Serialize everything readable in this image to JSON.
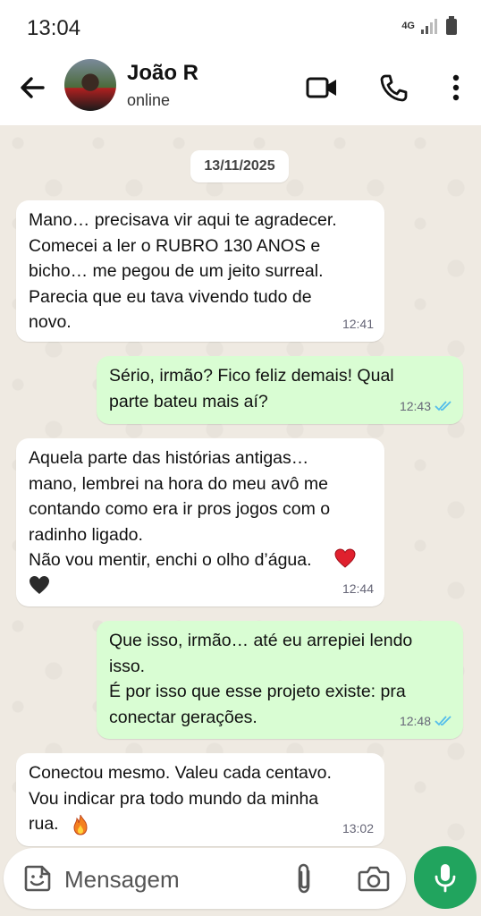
{
  "status_bar": {
    "time": "13:04",
    "network": "4G"
  },
  "header": {
    "contact_name": "João R",
    "contact_status": "online",
    "icons": [
      "back-arrow-icon",
      "video-call-icon",
      "phone-icon",
      "more-vert-icon"
    ]
  },
  "chat": {
    "date": "13/11/2025",
    "messages": [
      {
        "direction": "incoming",
        "text": "Mano… precisava vir aqui te agradecer.\nComecei a ler o RUBRO 130 ANOS e\nbicho… me pegou de um jeito surreal.\nParecia que eu tava vivendo tudo de\nnovo.",
        "time": "12:41"
      },
      {
        "direction": "outgoing",
        "text": "Sério, irmão? Fico feliz demais! Qual\nparte bateu mais aí?",
        "time": "12:43",
        "read": true
      },
      {
        "direction": "incoming",
        "text": "Aquela parte das histórias antigas…\nmano, lembrei na hora do meu avô me\ncontando como era ir pros jogos com o\nradinho ligado.\nNão vou mentir, enchi o olho d’água.",
        "emojis": [
          "red-heart",
          "black-heart"
        ],
        "time": "12:44"
      },
      {
        "direction": "outgoing",
        "text": "Que isso, irmão… até eu arrepiei lendo\nisso.\nÉ por isso que esse projeto existe: pra\nconectar gerações.",
        "time": "12:48",
        "read": true
      },
      {
        "direction": "incoming",
        "text": "Conectou mesmo. Valeu cada centavo.\nVou indicar pra todo mundo da minha\nrua.",
        "emojis": [
          "fire"
        ],
        "time": "13:02"
      }
    ]
  },
  "input": {
    "placeholder": "Mensagem"
  },
  "colors": {
    "outgoing_bubble": "#d9fdd3",
    "incoming_bubble": "#ffffff",
    "chat_background": "#efeae2",
    "mic_button": "#21a45e",
    "read_ticks": "#53bdeb"
  }
}
